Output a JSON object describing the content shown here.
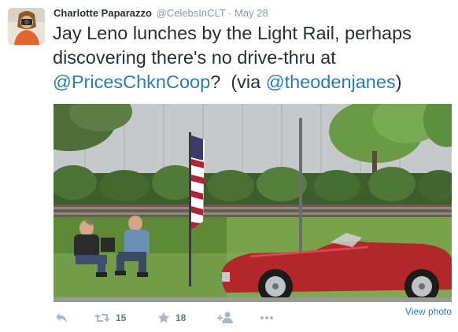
{
  "tweet": {
    "author_name": "Charlotte Paparazzo",
    "author_handle": "@CelebsInCLT",
    "separator": "·",
    "timestamp": "May 28",
    "text_line1": "Jay Leno lunches by the Light Rail, perhaps",
    "text_line2": "discovering there's no drive-thru at",
    "mention_1": "@PricesChknCoop",
    "text_mid": "?  (via ",
    "mention_2": "@theodenjanes",
    "text_end": ")"
  },
  "actions": {
    "retweet_count": "15",
    "favorite_count": "18",
    "view_photo_label": "View photo"
  },
  "icons": {
    "reply": "reply-icon",
    "retweet": "retweet-icon",
    "favorite": "star-icon",
    "follow": "follow-icon",
    "more": "more-icon"
  },
  "colors": {
    "link": "#2b7bb9",
    "meta": "#8899a6",
    "action_icon": "#aab8c2",
    "car_red": "#b3262a"
  }
}
